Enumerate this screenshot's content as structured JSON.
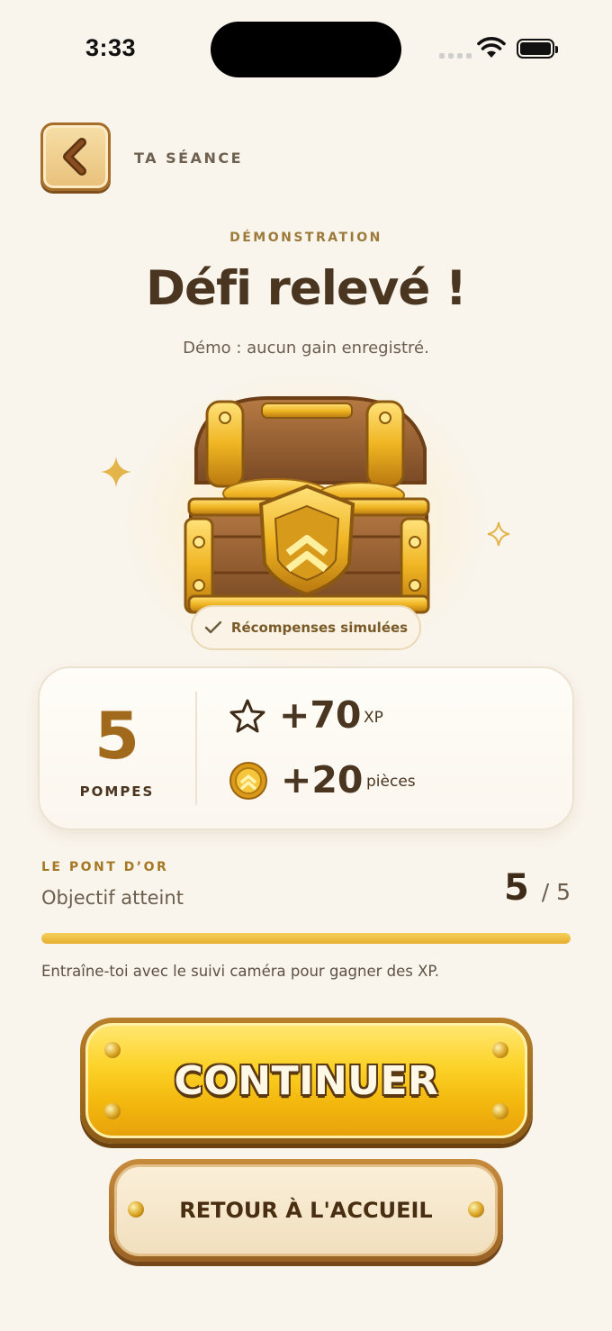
{
  "status_bar": {
    "time": "3:33"
  },
  "header": {
    "label": "TA SÉANCE"
  },
  "hero": {
    "eyebrow": "DÉMONSTRATION",
    "title": "Défi relevé !",
    "subtitle": "Démo : aucun gain enregistré.",
    "badge": "Récompenses simulées"
  },
  "stats": {
    "reps": "5",
    "reps_label": "POMPES",
    "xp_value": "+70",
    "xp_unit": "XP",
    "coins_value": "+20",
    "coins_unit": "pièces"
  },
  "quest": {
    "eyebrow": "LE PONT D’OR",
    "status": "Objectif atteint",
    "current": "5",
    "total": "/ 5",
    "progress": 1.0,
    "hint": "Entraîne-toi avec le suivi caméra pour gagner des XP."
  },
  "buttons": {
    "continue": "CONTINUER",
    "home": "RETOUR À L'ACCUEIL"
  },
  "colors": {
    "background": "#f9f4ec",
    "accent_gold": "#f3b80e",
    "brown_text": "#4a3520"
  }
}
